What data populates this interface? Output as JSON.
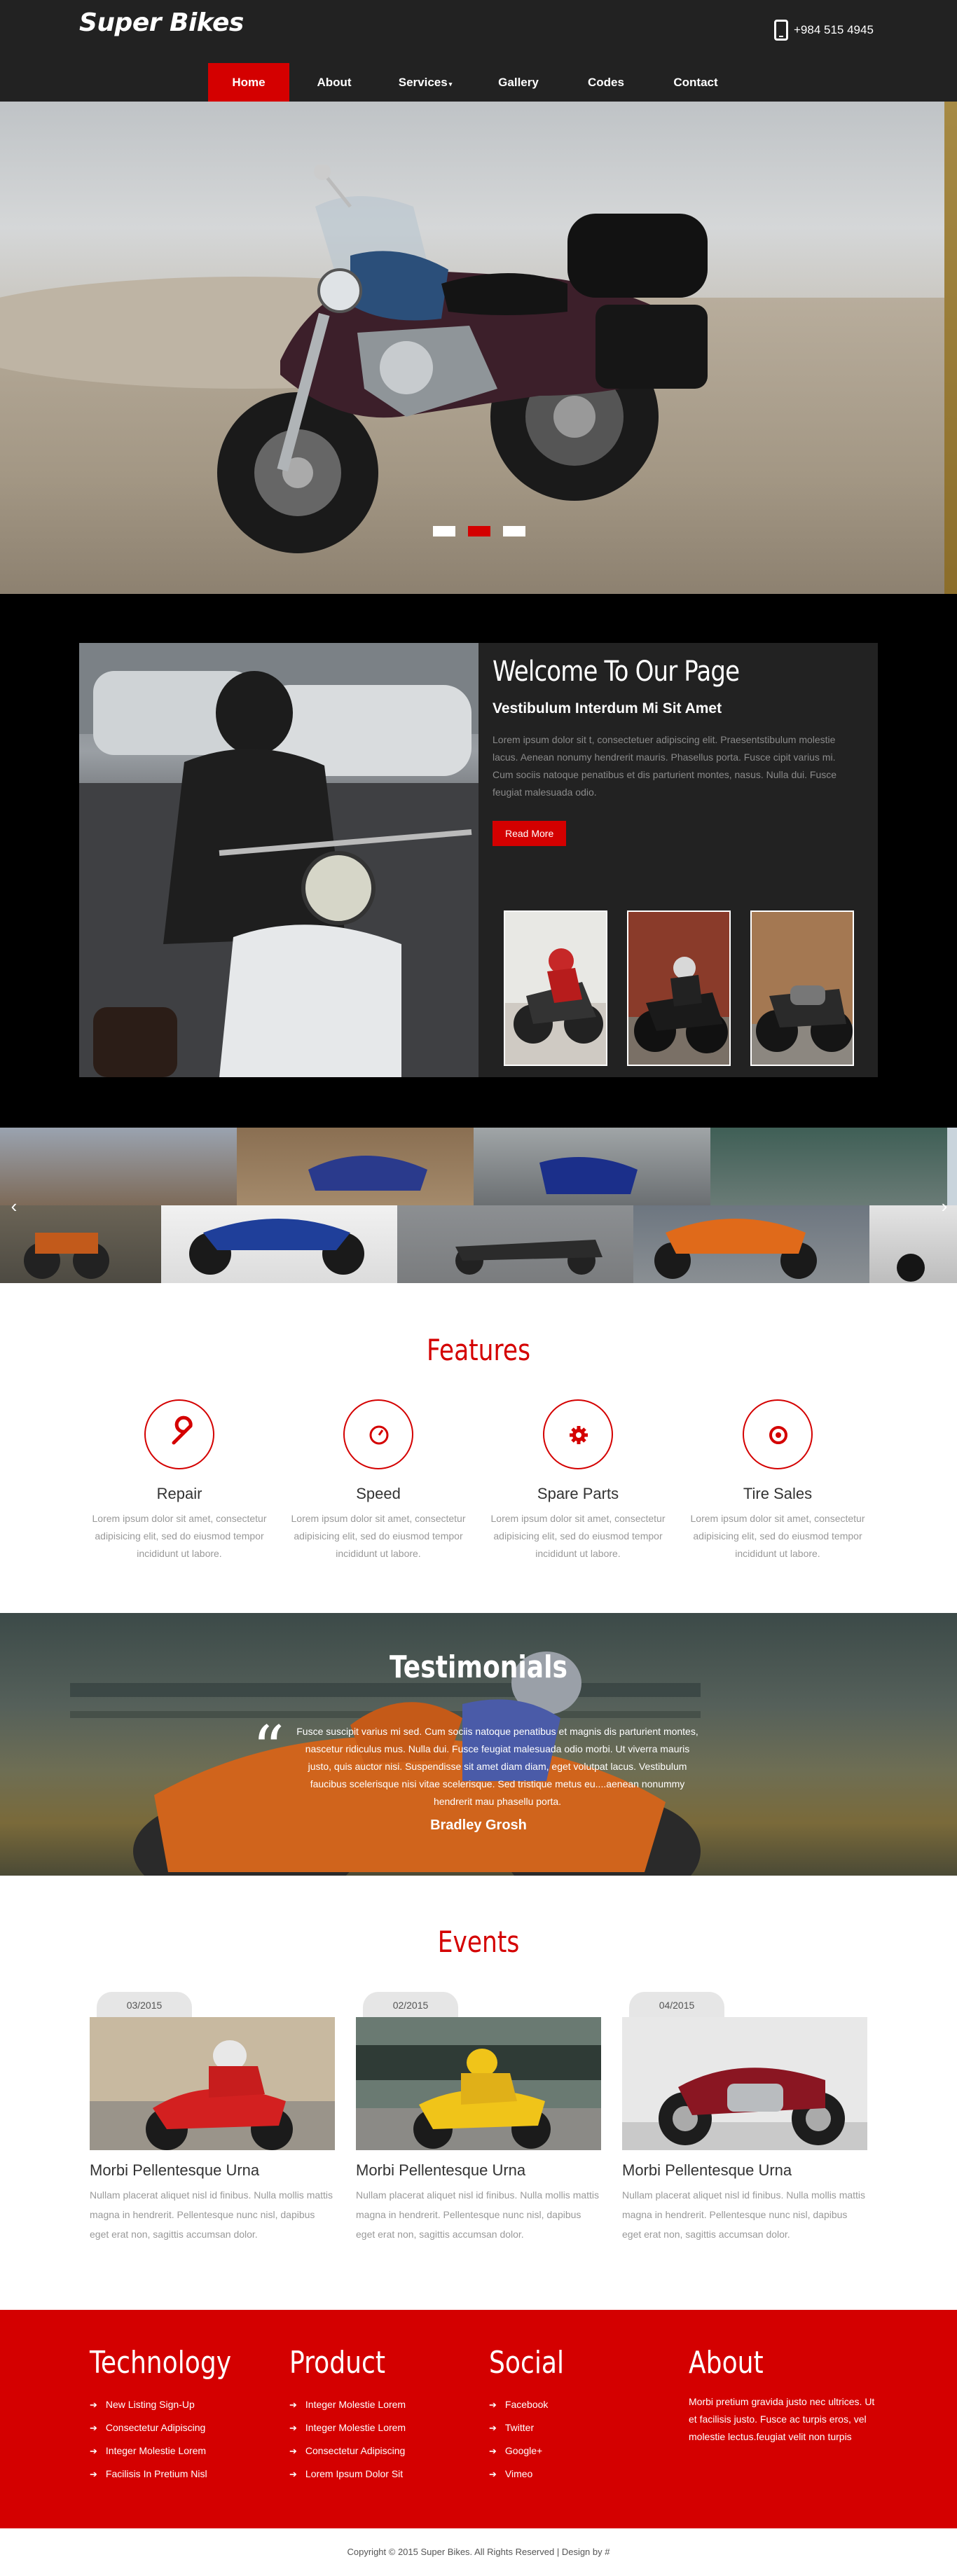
{
  "header": {
    "logo": "Super Bikes",
    "phone": "+984 515 4945",
    "nav": [
      {
        "label": "Home",
        "active": true
      },
      {
        "label": "About"
      },
      {
        "label": "Services",
        "has_dropdown": true
      },
      {
        "label": "Gallery"
      },
      {
        "label": "Codes"
      },
      {
        "label": "Contact"
      }
    ]
  },
  "hero": {
    "slides": 3,
    "active_slide": 2
  },
  "welcome": {
    "title": "Welcome To Our Page",
    "subtitle": "Vestibulum Interdum Mi Sit Amet",
    "description": "Lorem ipsum dolor sit t, consectetuer adipiscing elit. Praesentstibulum molestie lacus. Aenean nonumy hendrerit mauris. Phasellus porta. Fusce cipit varius mi. Cum sociis natoque penatibus et dis parturient montes, nasus. Nulla dui. Fusce feugiat malesuada odio.",
    "button": "Read More"
  },
  "features": {
    "title": "Features",
    "items": [
      {
        "icon": "wrench-icon",
        "title": "Repair",
        "desc": "Lorem ipsum dolor sit amet, consectetur adipisicing elit, sed do eiusmod tempor incididunt ut labore."
      },
      {
        "icon": "speedometer-icon",
        "title": "Speed",
        "desc": "Lorem ipsum dolor sit amet, consectetur adipisicing elit, sed do eiusmod tempor incididunt ut labore."
      },
      {
        "icon": "gear-icon",
        "title": "Spare Parts",
        "desc": "Lorem ipsum dolor sit amet, consectetur adipisicing elit, sed do eiusmod tempor incididunt ut labore."
      },
      {
        "icon": "tire-icon",
        "title": "Tire Sales",
        "desc": "Lorem ipsum dolor sit amet, consectetur adipisicing elit, sed do eiusmod tempor incididunt ut labore."
      }
    ]
  },
  "testimonials": {
    "title": "Testimonials",
    "quote": "Fusce suscipit varius mi sed. Cum sociis natoque penatibus et magnis dis parturient montes, nascetur ridiculus mus. Nulla dui. Fusce feugiat malesuada odio morbi. Ut viverra mauris justo, quis auctor nisi. Suspendisse sit amet diam diam, eget volutpat lacus. Vestibulum faucibus scelerisque nisi vitae scelerisque. Sed tristique metus eu....aenean nonummy hendrerit mau phasellu porta.",
    "author": "Bradley Grosh"
  },
  "events": {
    "title": "Events",
    "items": [
      {
        "date": "03/2015",
        "title": "Morbi Pellentesque Urna",
        "desc": "Nullam placerat aliquet nisl id finibus. Nulla mollis mattis magna in hendrerit. Pellentesque nunc nisl, dapibus eget erat non, sagittis accumsan dolor."
      },
      {
        "date": "02/2015",
        "title": "Morbi Pellentesque Urna",
        "desc": "Nullam placerat aliquet nisl id finibus. Nulla mollis mattis magna in hendrerit. Pellentesque nunc nisl, dapibus eget erat non, sagittis accumsan dolor."
      },
      {
        "date": "04/2015",
        "title": "Morbi Pellentesque Urna",
        "desc": "Nullam placerat aliquet nisl id finibus. Nulla mollis mattis magna in hendrerit. Pellentesque nunc nisl, dapibus eget erat non, sagittis accumsan dolor."
      }
    ]
  },
  "footer": {
    "technology": {
      "title": "Technology",
      "links": [
        "New Listing Sign-Up",
        "Consectetur Adipiscing",
        "Integer Molestie Lorem",
        "Facilisis In Pretium Nisl"
      ]
    },
    "product": {
      "title": "Product",
      "links": [
        "Integer Molestie Lorem",
        "Integer Molestie Lorem",
        "Consectetur Adipiscing",
        "Lorem Ipsum Dolor Sit"
      ]
    },
    "social": {
      "title": "Social",
      "links": [
        "Facebook",
        "Twitter",
        "Google+",
        "Vimeo"
      ]
    },
    "about": {
      "title": "About",
      "text": "Morbi pretium gravida justo nec ultrices. Ut et facilisis justo. Fusce ac turpis eros, vel molestie lectus.feugiat velit non turpis"
    },
    "copyright": "Copyright © 2015 Super Bikes. All Rights Reserved | Design by #"
  },
  "colors": {
    "accent": "#d40000",
    "header_bg": "#222222",
    "dark_bg": "#000000"
  }
}
